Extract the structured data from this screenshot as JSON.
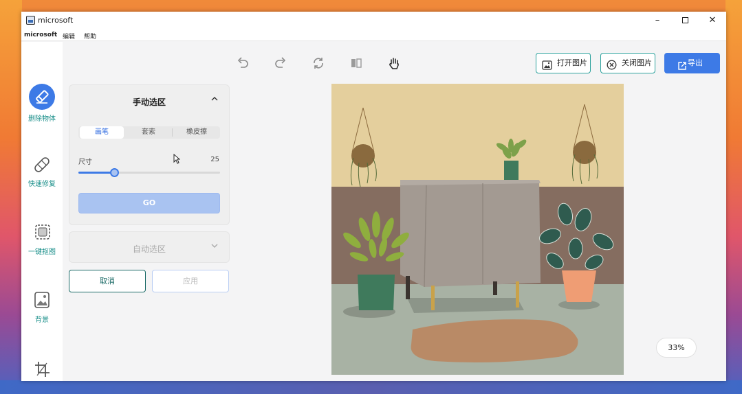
{
  "window": {
    "title": "microsoft",
    "minimize": "–",
    "close": "✕"
  },
  "menu": {
    "items": [
      "microsoft",
      "编辑",
      "帮助"
    ]
  },
  "sidebar": {
    "items": [
      {
        "label": "删除物体",
        "icon": "eraser-icon"
      },
      {
        "label": "快速修复",
        "icon": "bandage-icon"
      },
      {
        "label": "一键抠图",
        "icon": "cutout-icon"
      },
      {
        "label": "背景",
        "icon": "background-image-icon"
      },
      {
        "label": "",
        "icon": "crop-icon"
      }
    ]
  },
  "toolbar": {
    "icons": [
      "undo-icon",
      "redo-icon",
      "reset-icon",
      "compare-icon",
      "hand-icon"
    ],
    "open_image": "打开图片",
    "close_image": "关闭图片",
    "export": "导出"
  },
  "manual_panel": {
    "title": "手动选区",
    "tabs": [
      "画笔",
      "套索",
      "橡皮擦"
    ],
    "active_tab": 0,
    "size_label": "尺寸",
    "size_value": "25",
    "go_label": "GO"
  },
  "auto_panel": {
    "title": "自动选区"
  },
  "actions": {
    "cancel": "取消",
    "apply": "应用"
  },
  "zoom": "33%",
  "colors": {
    "accent": "#3d7ae6",
    "teal": "#2aa19c",
    "wall_top": "#e4cf9d",
    "wall_bottom": "#856d60",
    "floor": "#a8b2a4",
    "cabinet": "#a39a92",
    "rug": "#b98a66"
  }
}
